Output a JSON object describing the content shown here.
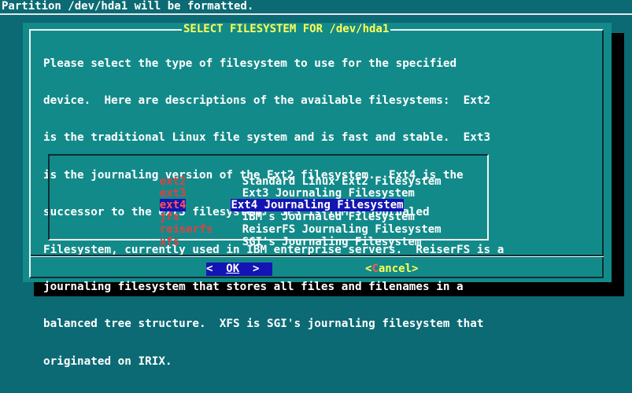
{
  "status_bar": {
    "text": "Partition /dev/hda1 will be formatted."
  },
  "dialog": {
    "title": "SELECT FILESYSTEM FOR /dev/hda1",
    "description_lines": [
      "Please select the type of filesystem to use for the specified",
      "device.  Here are descriptions of the available filesystems:  Ext2",
      "is the traditional Linux file system and is fast and stable.  Ext3",
      "is the journaling version of the Ext2 filesystem.  Ext4 is the",
      "successor to the ext3 filesystem.  JFS is IBM's Journaled",
      "Filesystem, currently used in IBM enterprise servers.  ReiserFS is a",
      "journaling filesystem that stores all files and filenames in a",
      "balanced tree structure.  XFS is SGI's journaling filesystem that",
      "originated on IRIX."
    ],
    "options": [
      {
        "tag": "ext2",
        "item": "Standard Linux Ext2 Filesystem",
        "selected": false
      },
      {
        "tag": "ext3",
        "item": "Ext3 Journaling Filesystem",
        "selected": false
      },
      {
        "tag": "ext4",
        "item": "Ext4 Journaling Filesystem",
        "selected": true
      },
      {
        "tag": "jfs",
        "item": "IBM's Journaled Filesystem",
        "selected": false
      },
      {
        "tag": "reiserfs",
        "item": "ReiserFS Journaling Filesystem",
        "selected": false
      },
      {
        "tag": "xfs",
        "item": "SGI's Journaling Filesystem",
        "selected": false
      }
    ],
    "buttons": {
      "ok": {
        "left": "<  ",
        "hotkey": "OK",
        "right": "  >"
      },
      "cancel": {
        "left": "<",
        "hotkey": "C",
        "rest": "ancel",
        "right": ">"
      }
    }
  },
  "colors": {
    "background": "#0b6a74",
    "dialog": "#138a8a",
    "highlight": "#1414b4",
    "title_text": "#ffff55",
    "tag_text": "#e04040"
  }
}
